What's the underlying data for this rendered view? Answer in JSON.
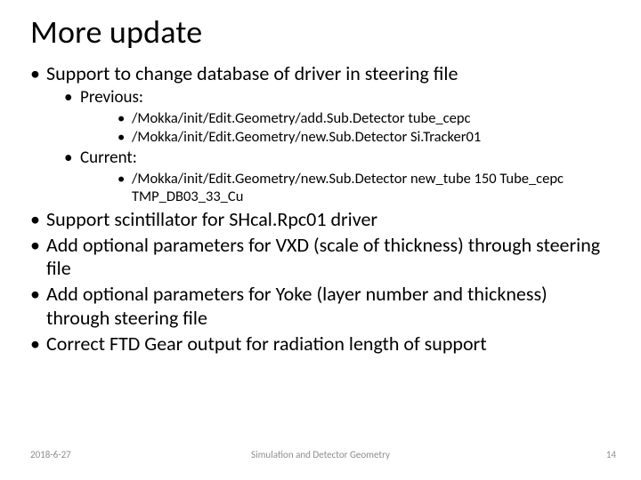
{
  "title": "More update",
  "bullets": {
    "b1": "Support to change database of driver in steering file",
    "b1_1": "Previous:",
    "b1_1_1": "/Mokka/init/Edit.Geometry/add.Sub.Detector tube_cepc",
    "b1_1_2": "/Mokka/init/Edit.Geometry/new.Sub.Detector Si.Tracker01",
    "b1_2": "Current:",
    "b1_2_1": "/Mokka/init/Edit.Geometry/new.Sub.Detector new_tube 150 Tube_cepc TMP_DB03_33_Cu",
    "b2": "Support scintillator for SHcal.Rpc01 driver",
    "b3": "Add optional parameters for VXD (scale of thickness) through steering file",
    "b4": "Add optional parameters for Yoke (layer number and thickness) through steering file",
    "b5": "Correct FTD Gear output for radiation length of support"
  },
  "footer": {
    "date": "2018-6-27",
    "center": "Simulation and Detector Geometry",
    "page": "14"
  }
}
